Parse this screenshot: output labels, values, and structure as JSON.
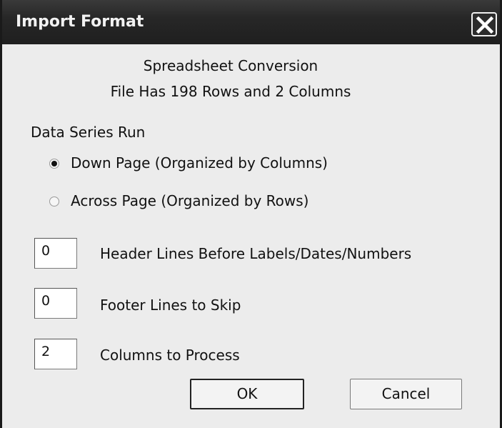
{
  "window": {
    "title": "Import Format"
  },
  "header": {
    "line1": "Spreadsheet Conversion",
    "line2": "File Has 198 Rows and 2 Columns"
  },
  "series_run": {
    "label": "Data Series Run",
    "options": [
      {
        "label": "Down Page (Organized by Columns)",
        "selected": true
      },
      {
        "label": "Across Page (Organized by Rows)",
        "selected": false
      }
    ]
  },
  "fields": [
    {
      "value": "0",
      "label": "Header Lines Before Labels/Dates/Numbers"
    },
    {
      "value": "0",
      "label": "Footer Lines to Skip"
    },
    {
      "value": "2",
      "label": "Columns to Process"
    }
  ],
  "buttons": {
    "ok": "OK",
    "cancel": "Cancel"
  },
  "icons": {
    "close": "close-icon"
  }
}
